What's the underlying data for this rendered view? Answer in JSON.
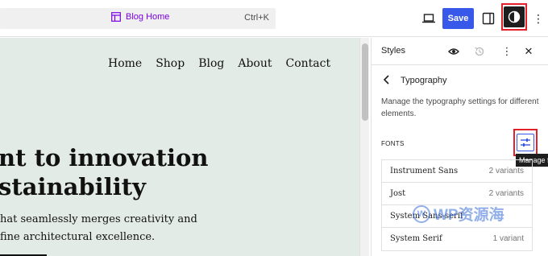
{
  "topbar": {
    "doc_title": "Blog Home",
    "shortcut": "Ctrl+K",
    "save_label": "Save",
    "icons": {
      "device": "desktop-icon",
      "panel": "sidebar-toggle-icon",
      "styles": "styles-contrast-icon",
      "options": "kebab-menu-icon"
    },
    "accent_color": "#3858e9",
    "highlight_color": "#e2202a"
  },
  "canvas": {
    "nav": [
      "Home",
      "Shop",
      "Blog",
      "About",
      "Contact"
    ],
    "heading_line1": "nt to innovation",
    "heading_line2": "stainability",
    "para_line1": "hat seamlessly merges creativity and",
    "para_line2": "fine architectural excellence.",
    "background_color": "#e3ebe7"
  },
  "sidebar": {
    "title": "Styles",
    "section_title": "Typography",
    "description": "Manage the typography settings for different elements.",
    "fonts_label": "FONTS",
    "manage_tooltip": "Manage fonts",
    "fonts": [
      {
        "name": "Instrument Sans",
        "variants": "2 variants"
      },
      {
        "name": "Jost",
        "variants": "2 variants"
      },
      {
        "name": "System Sans-serif",
        "variants": ""
      },
      {
        "name": "System Serif",
        "variants": "1 variant"
      }
    ]
  },
  "watermark": {
    "text": "WP资源海"
  }
}
